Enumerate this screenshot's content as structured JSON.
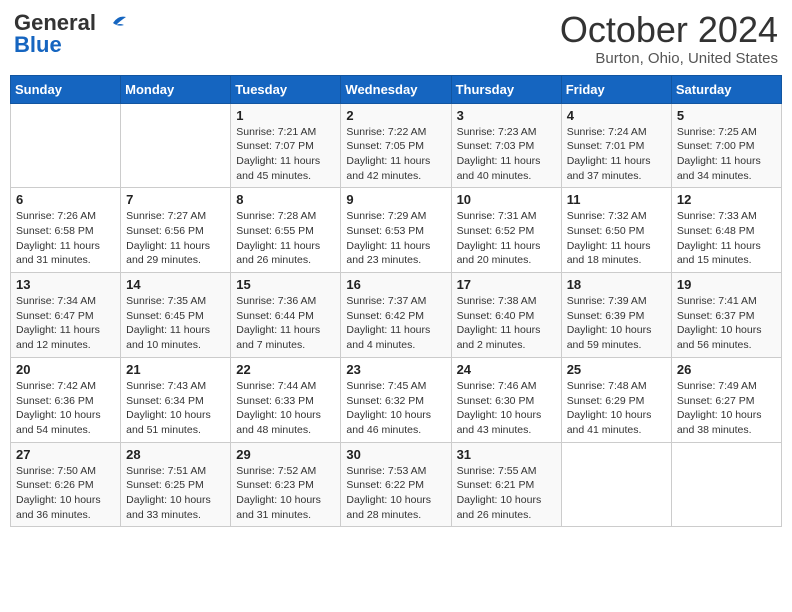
{
  "header": {
    "logo_general": "General",
    "logo_blue": "Blue",
    "month": "October 2024",
    "location": "Burton, Ohio, United States"
  },
  "weekdays": [
    "Sunday",
    "Monday",
    "Tuesday",
    "Wednesday",
    "Thursday",
    "Friday",
    "Saturday"
  ],
  "weeks": [
    [
      {
        "day": "",
        "sunrise": "",
        "sunset": "",
        "daylight": ""
      },
      {
        "day": "",
        "sunrise": "",
        "sunset": "",
        "daylight": ""
      },
      {
        "day": "1",
        "sunrise": "Sunrise: 7:21 AM",
        "sunset": "Sunset: 7:07 PM",
        "daylight": "Daylight: 11 hours and 45 minutes."
      },
      {
        "day": "2",
        "sunrise": "Sunrise: 7:22 AM",
        "sunset": "Sunset: 7:05 PM",
        "daylight": "Daylight: 11 hours and 42 minutes."
      },
      {
        "day": "3",
        "sunrise": "Sunrise: 7:23 AM",
        "sunset": "Sunset: 7:03 PM",
        "daylight": "Daylight: 11 hours and 40 minutes."
      },
      {
        "day": "4",
        "sunrise": "Sunrise: 7:24 AM",
        "sunset": "Sunset: 7:01 PM",
        "daylight": "Daylight: 11 hours and 37 minutes."
      },
      {
        "day": "5",
        "sunrise": "Sunrise: 7:25 AM",
        "sunset": "Sunset: 7:00 PM",
        "daylight": "Daylight: 11 hours and 34 minutes."
      }
    ],
    [
      {
        "day": "6",
        "sunrise": "Sunrise: 7:26 AM",
        "sunset": "Sunset: 6:58 PM",
        "daylight": "Daylight: 11 hours and 31 minutes."
      },
      {
        "day": "7",
        "sunrise": "Sunrise: 7:27 AM",
        "sunset": "Sunset: 6:56 PM",
        "daylight": "Daylight: 11 hours and 29 minutes."
      },
      {
        "day": "8",
        "sunrise": "Sunrise: 7:28 AM",
        "sunset": "Sunset: 6:55 PM",
        "daylight": "Daylight: 11 hours and 26 minutes."
      },
      {
        "day": "9",
        "sunrise": "Sunrise: 7:29 AM",
        "sunset": "Sunset: 6:53 PM",
        "daylight": "Daylight: 11 hours and 23 minutes."
      },
      {
        "day": "10",
        "sunrise": "Sunrise: 7:31 AM",
        "sunset": "Sunset: 6:52 PM",
        "daylight": "Daylight: 11 hours and 20 minutes."
      },
      {
        "day": "11",
        "sunrise": "Sunrise: 7:32 AM",
        "sunset": "Sunset: 6:50 PM",
        "daylight": "Daylight: 11 hours and 18 minutes."
      },
      {
        "day": "12",
        "sunrise": "Sunrise: 7:33 AM",
        "sunset": "Sunset: 6:48 PM",
        "daylight": "Daylight: 11 hours and 15 minutes."
      }
    ],
    [
      {
        "day": "13",
        "sunrise": "Sunrise: 7:34 AM",
        "sunset": "Sunset: 6:47 PM",
        "daylight": "Daylight: 11 hours and 12 minutes."
      },
      {
        "day": "14",
        "sunrise": "Sunrise: 7:35 AM",
        "sunset": "Sunset: 6:45 PM",
        "daylight": "Daylight: 11 hours and 10 minutes."
      },
      {
        "day": "15",
        "sunrise": "Sunrise: 7:36 AM",
        "sunset": "Sunset: 6:44 PM",
        "daylight": "Daylight: 11 hours and 7 minutes."
      },
      {
        "day": "16",
        "sunrise": "Sunrise: 7:37 AM",
        "sunset": "Sunset: 6:42 PM",
        "daylight": "Daylight: 11 hours and 4 minutes."
      },
      {
        "day": "17",
        "sunrise": "Sunrise: 7:38 AM",
        "sunset": "Sunset: 6:40 PM",
        "daylight": "Daylight: 11 hours and 2 minutes."
      },
      {
        "day": "18",
        "sunrise": "Sunrise: 7:39 AM",
        "sunset": "Sunset: 6:39 PM",
        "daylight": "Daylight: 10 hours and 59 minutes."
      },
      {
        "day": "19",
        "sunrise": "Sunrise: 7:41 AM",
        "sunset": "Sunset: 6:37 PM",
        "daylight": "Daylight: 10 hours and 56 minutes."
      }
    ],
    [
      {
        "day": "20",
        "sunrise": "Sunrise: 7:42 AM",
        "sunset": "Sunset: 6:36 PM",
        "daylight": "Daylight: 10 hours and 54 minutes."
      },
      {
        "day": "21",
        "sunrise": "Sunrise: 7:43 AM",
        "sunset": "Sunset: 6:34 PM",
        "daylight": "Daylight: 10 hours and 51 minutes."
      },
      {
        "day": "22",
        "sunrise": "Sunrise: 7:44 AM",
        "sunset": "Sunset: 6:33 PM",
        "daylight": "Daylight: 10 hours and 48 minutes."
      },
      {
        "day": "23",
        "sunrise": "Sunrise: 7:45 AM",
        "sunset": "Sunset: 6:32 PM",
        "daylight": "Daylight: 10 hours and 46 minutes."
      },
      {
        "day": "24",
        "sunrise": "Sunrise: 7:46 AM",
        "sunset": "Sunset: 6:30 PM",
        "daylight": "Daylight: 10 hours and 43 minutes."
      },
      {
        "day": "25",
        "sunrise": "Sunrise: 7:48 AM",
        "sunset": "Sunset: 6:29 PM",
        "daylight": "Daylight: 10 hours and 41 minutes."
      },
      {
        "day": "26",
        "sunrise": "Sunrise: 7:49 AM",
        "sunset": "Sunset: 6:27 PM",
        "daylight": "Daylight: 10 hours and 38 minutes."
      }
    ],
    [
      {
        "day": "27",
        "sunrise": "Sunrise: 7:50 AM",
        "sunset": "Sunset: 6:26 PM",
        "daylight": "Daylight: 10 hours and 36 minutes."
      },
      {
        "day": "28",
        "sunrise": "Sunrise: 7:51 AM",
        "sunset": "Sunset: 6:25 PM",
        "daylight": "Daylight: 10 hours and 33 minutes."
      },
      {
        "day": "29",
        "sunrise": "Sunrise: 7:52 AM",
        "sunset": "Sunset: 6:23 PM",
        "daylight": "Daylight: 10 hours and 31 minutes."
      },
      {
        "day": "30",
        "sunrise": "Sunrise: 7:53 AM",
        "sunset": "Sunset: 6:22 PM",
        "daylight": "Daylight: 10 hours and 28 minutes."
      },
      {
        "day": "31",
        "sunrise": "Sunrise: 7:55 AM",
        "sunset": "Sunset: 6:21 PM",
        "daylight": "Daylight: 10 hours and 26 minutes."
      },
      {
        "day": "",
        "sunrise": "",
        "sunset": "",
        "daylight": ""
      },
      {
        "day": "",
        "sunrise": "",
        "sunset": "",
        "daylight": ""
      }
    ]
  ]
}
